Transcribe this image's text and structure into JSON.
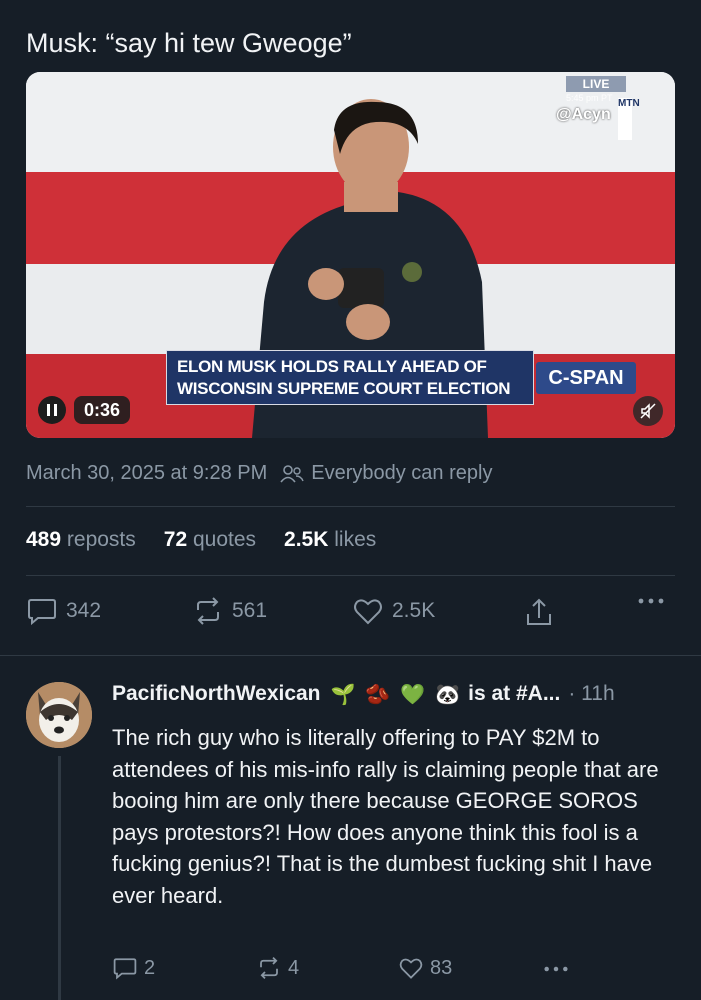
{
  "post": {
    "text": "Musk: “say hi tew Gweoge”",
    "timestamp": "March 30, 2025 at 9:28 PM",
    "reply_setting": "Everybody can reply",
    "stats": [
      {
        "num": "489",
        "label": "reposts"
      },
      {
        "num": "72",
        "label": "quotes"
      },
      {
        "num": "2.5K",
        "label": "likes"
      }
    ],
    "actions": {
      "replies": "342",
      "reposts": "561",
      "likes": "2.5K"
    }
  },
  "video": {
    "elapsed": "0:36",
    "chyron_line1": "ELON MUSK HOLDS RALLY AHEAD OF",
    "chyron_line2": "WISCONSIN SUPREME COURT ELECTION",
    "network": "C-SPAN",
    "live_badge": "LIVE",
    "live_time": "5:45 pm PT",
    "handle": "@Acyn",
    "mtn": "MTN",
    "colors": {
      "red": "#cf3038",
      "navy": "#1f3566"
    }
  },
  "reply": {
    "name": "PacificNorthWexican",
    "emojis": [
      "🌱",
      "🫘",
      "💚",
      "🐼"
    ],
    "name_suffix": "is at #A...",
    "time": "· 11h",
    "text": "The rich guy who is literally offering to PAY $2M to attendees of his mis-info rally is claiming people that are booing him are only there because GEORGE SOROS pays protestors?! How does anyone think this fool is a fucking genius?! That is the dumbest fucking shit I have ever heard.",
    "actions": {
      "replies": "2",
      "reposts": "4",
      "likes": "83"
    }
  },
  "icons": [
    "pause-icon",
    "mute-icon",
    "people-icon",
    "reply-icon",
    "repost-icon",
    "heart-icon",
    "share-icon",
    "more-icon"
  ]
}
